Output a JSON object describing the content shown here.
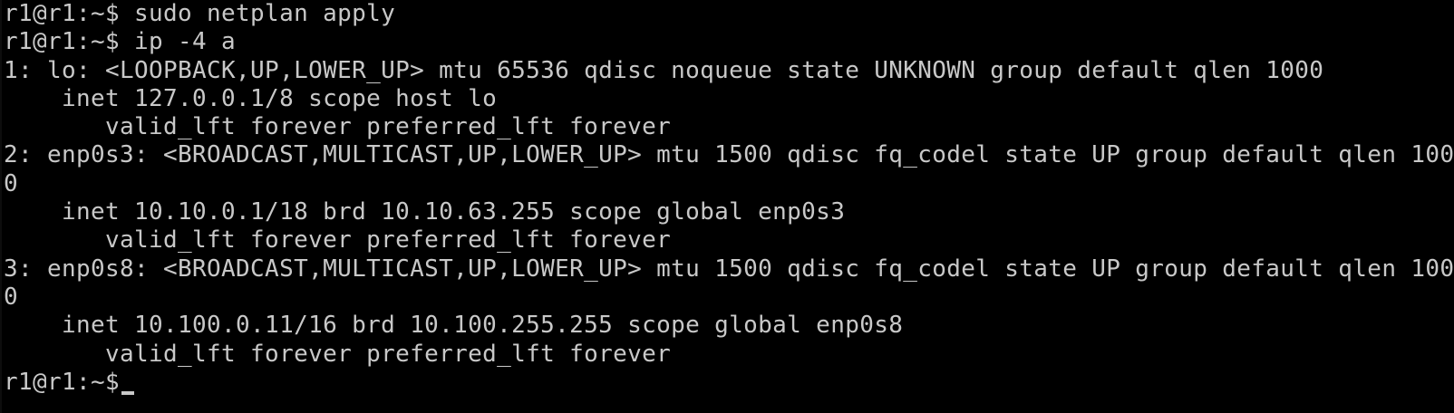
{
  "terminal": {
    "lines": [
      "r1@r1:~$ sudo netplan apply",
      "r1@r1:~$ ip -4 a",
      "1: lo: <LOOPBACK,UP,LOWER_UP> mtu 65536 qdisc noqueue state UNKNOWN group default qlen 1000",
      "    inet 127.0.0.1/8 scope host lo",
      "       valid_lft forever preferred_lft forever",
      "2: enp0s3: <BROADCAST,MULTICAST,UP,LOWER_UP> mtu 1500 qdisc fq_codel state UP group default qlen 100",
      "0",
      "    inet 10.10.0.1/18 brd 10.10.63.255 scope global enp0s3",
      "       valid_lft forever preferred_lft forever",
      "3: enp0s8: <BROADCAST,MULTICAST,UP,LOWER_UP> mtu 1500 qdisc fq_codel state UP group default qlen 100",
      "0",
      "    inet 10.100.0.11/16 brd 10.100.255.255 scope global enp0s8",
      "       valid_lft forever preferred_lft forever"
    ],
    "prompt": "r1@r1:~$"
  }
}
